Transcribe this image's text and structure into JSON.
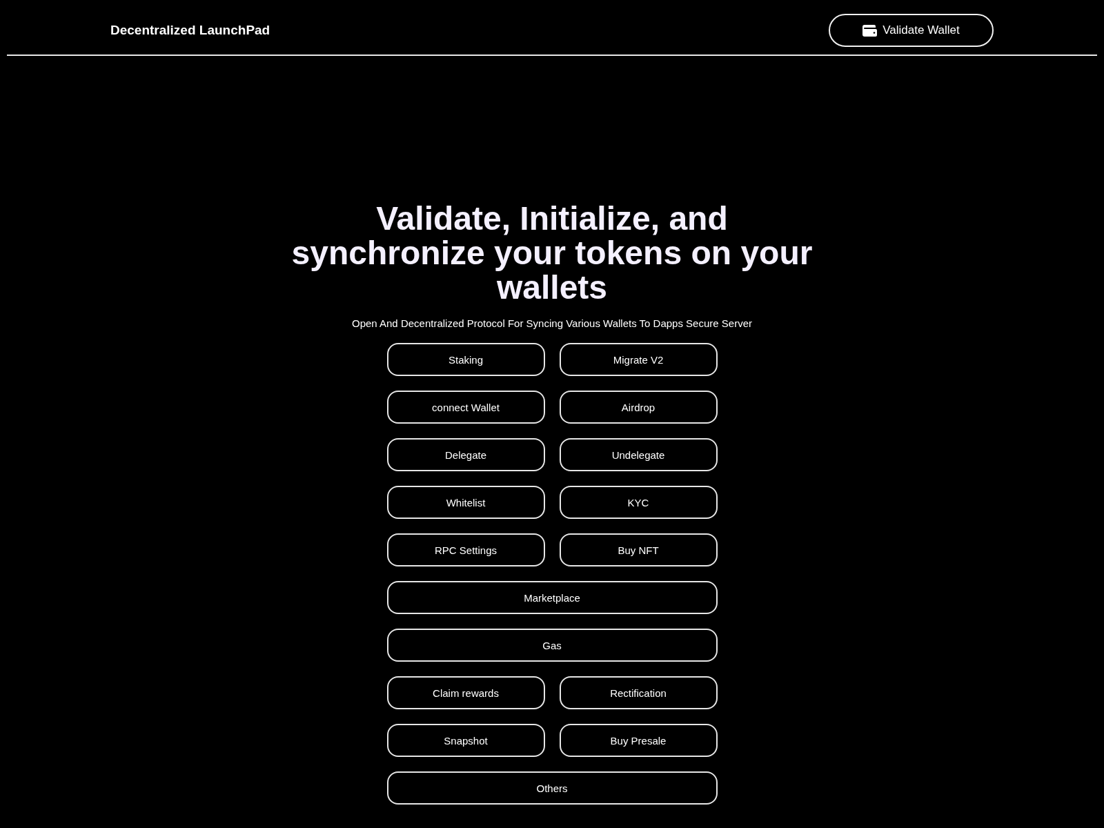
{
  "header": {
    "title": "Decentralized LaunchPad",
    "wallet_button": "Validate Wallet"
  },
  "hero": {
    "heading": "Validate, Initialize, and synchronize your tokens on your wallets",
    "subtitle": "Open And Decentralized Protocol For Syncing Various Wallets To Dapps Secure Server"
  },
  "actions": [
    {
      "label": "Staking",
      "kind": "half"
    },
    {
      "label": "Migrate V2",
      "kind": "half"
    },
    {
      "label": "connect Wallet",
      "kind": "half"
    },
    {
      "label": "Airdrop",
      "kind": "half"
    },
    {
      "label": "Delegate",
      "kind": "half"
    },
    {
      "label": "Undelegate",
      "kind": "half"
    },
    {
      "label": "Whitelist",
      "kind": "half"
    },
    {
      "label": "KYC",
      "kind": "half"
    },
    {
      "label": "RPC Settings",
      "kind": "half"
    },
    {
      "label": "Buy NFT",
      "kind": "half"
    },
    {
      "label": "Marketplace",
      "kind": "wide"
    },
    {
      "label": "Gas",
      "kind": "wide"
    },
    {
      "label": "Claim rewards",
      "kind": "half"
    },
    {
      "label": "Rectification",
      "kind": "half"
    },
    {
      "label": "Snapshot",
      "kind": "half"
    },
    {
      "label": "Buy Presale",
      "kind": "half"
    },
    {
      "label": "Others",
      "kind": "wide"
    }
  ]
}
